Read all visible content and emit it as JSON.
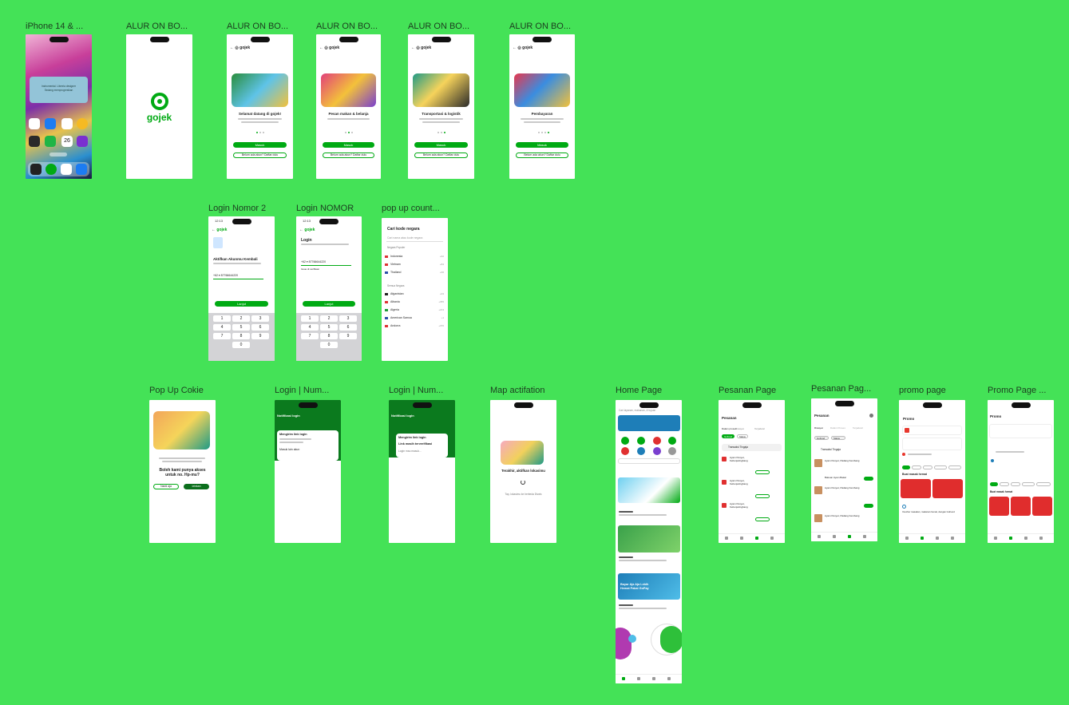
{
  "canvas": {
    "background": "#44e257",
    "accent": "#00aa13"
  },
  "frames": {
    "iphone": {
      "label": "iPhone 14 & ...",
      "widget_text": "Instrumental. Libreria designer\nSedang memprogresikan",
      "calendar_day": "26"
    },
    "splash": {
      "label": "ALUR ON BO...",
      "brand": "gojek"
    },
    "onboard1": {
      "label": "ALUR ON BO...",
      "title": "Selamat datang di gojek!",
      "btn_primary": "Masuk",
      "btn_secondary": "Belum ada akun? Daftar dulu"
    },
    "onboard2": {
      "label": "ALUR ON BO...",
      "title": "Pesan makan & belanja",
      "btn_primary": "Masuk",
      "btn_secondary": "Belum ada akun? Daftar dulu"
    },
    "onboard3": {
      "label": "ALUR ON BO...",
      "title": "Transportasi & logistik",
      "btn_primary": "Masuk",
      "btn_secondary": "Belum ada akun? Daftar dulu"
    },
    "onboard4": {
      "label": "ALUR ON BO...",
      "title": "Pembayaran",
      "btn_primary": "Masuk",
      "btn_secondary": "Belum ada akun? Daftar dulu"
    },
    "login2": {
      "label": "Login Nomor 2",
      "brand": "gojek",
      "title": "Aktifkan Akunmu Kembali",
      "phone_value": "87766644220",
      "button": "Lanjut",
      "time": "12:13"
    },
    "loginNomor": {
      "label": "Login NOMOR",
      "brand": "gojek",
      "title": "Login",
      "phone_value": "87766644220",
      "link": "Issue di verifikasi",
      "button": "Lanjut",
      "time": "12:13"
    },
    "popupCountry": {
      "label": "pop up count...",
      "title": "Cari kode negara",
      "search_placeholder": "Cari nama atau kode negara",
      "popular_header": "Negara Populer",
      "popular": [
        {
          "name": "Indonesia",
          "code": "+62"
        },
        {
          "name": "Vietnam",
          "code": "+84"
        },
        {
          "name": "Thailand",
          "code": "+66"
        }
      ],
      "all_header": "Semua Negara",
      "all": [
        {
          "name": "Afganistan",
          "code": "+93"
        },
        {
          "name": "Albania",
          "code": "+355"
        },
        {
          "name": "Algeria",
          "code": "+213"
        },
        {
          "name": "American Samoa",
          "code": "+1"
        },
        {
          "name": "Andorra",
          "code": "+376"
        }
      ]
    },
    "popupCookie": {
      "label": "Pop Up Cokie",
      "title": "Boleh kami punya akses untuk no. Hp-mu?",
      "btn_deny": "Nanti aja",
      "btn_allow": "Izinkan"
    },
    "loginNum1": {
      "label": "Login | Num...",
      "title": "Notifikasi login",
      "option1": "Mengirim link login",
      "option2": "Masuk lain akun"
    },
    "loginNum2": {
      "label": "Login | Num...",
      "title": "Notifikasi login",
      "option1": "Mengirim link login",
      "option2": "Link masih terverifikasi",
      "option3": "Login mau masuk..."
    },
    "mapActivation": {
      "label": "Map actifation",
      "title": "Terakhir, aktifkan lokasimu",
      "sub": "Tap, lokasimu ke berbeda Divais"
    },
    "homePage": {
      "label": "Home Page",
      "search_placeholder": "Cari layanan, makanan, & tujuan",
      "promo_title": "Bayar Aja Aja Lebih Hemat Pakai GoPay"
    },
    "pesanan1": {
      "label": "Pesanan Page",
      "title": "Pesanan",
      "tabs": [
        "Dalam proses",
        "Riwayat",
        "Terjadwal"
      ],
      "chips": [
        "GoFood",
        "Status"
      ],
      "banner": "Transaksi Tingaja",
      "items": [
        "Ayam Penyet, Kebunjaringbang",
        "Ayam Penyet, Kebunjaringbang",
        "Ayam Penyet, Kebunjaringbang"
      ]
    },
    "pesanan2": {
      "label": "Pesanan Pag...",
      "title": "Pesanan",
      "tabs": [
        "Riwayat",
        "Dalam Proses",
        "Terjadwal"
      ],
      "chips": [
        "GoFood",
        "Status"
      ],
      "banner": "Transaksi Tingaja",
      "items": [
        "Ayam Penyet, Padang Kembang",
        "Bakuan Ayam Bakar",
        "Ayam Penyet, Padang Kembang",
        "Ayam Penyet, Padang Kembang"
      ]
    },
    "promo1": {
      "label": "promo page",
      "title": "Promo",
      "section": "Buat masak hemat",
      "footer": "Voucher masakan, makanan hemat, dengan GoFood"
    },
    "promo2": {
      "label": "Promo Page ...",
      "title": "Promo",
      "section": "Buat masak hemat"
    }
  }
}
